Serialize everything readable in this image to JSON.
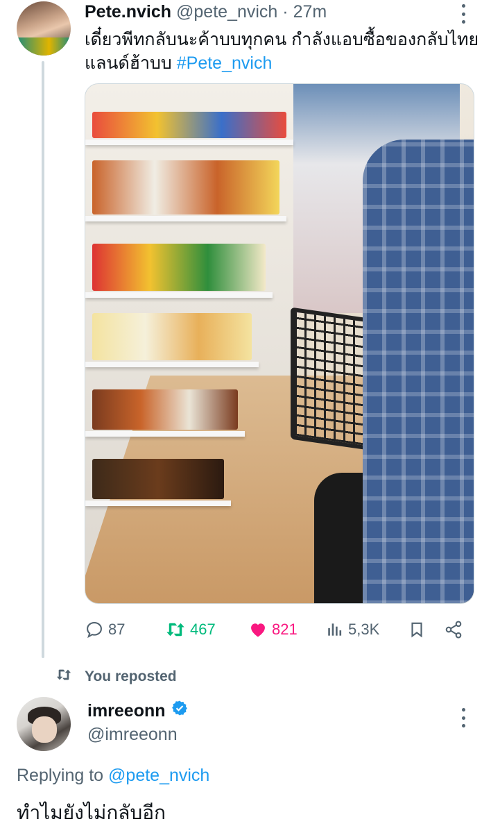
{
  "tweet": {
    "display_name": "Pete.nvich",
    "handle": "@pete_nvich",
    "separator": "·",
    "time": "27m",
    "text_before_hashtag": "เดี๋ยวพีทกลับนะค้าบบทุกคน กำลังแอบซื้อของกลับไทยแลนด์ฮ้าบบ",
    "hashtag": "#Pete_nvich",
    "actions": {
      "replies": "87",
      "retweets": "467",
      "likes": "821",
      "views": "5,3K"
    },
    "colors": {
      "retweet_active": "#00ba7c",
      "like_active": "#f91880",
      "link": "#1d9bf0"
    }
  },
  "repost": {
    "label": "You reposted"
  },
  "reply": {
    "display_name": "imreeonn",
    "handle": "@imreeonn",
    "replying_prefix": "Replying to",
    "replying_to": "@pete_nvich",
    "text": "ทำไมยังไม่กลับอีก"
  }
}
